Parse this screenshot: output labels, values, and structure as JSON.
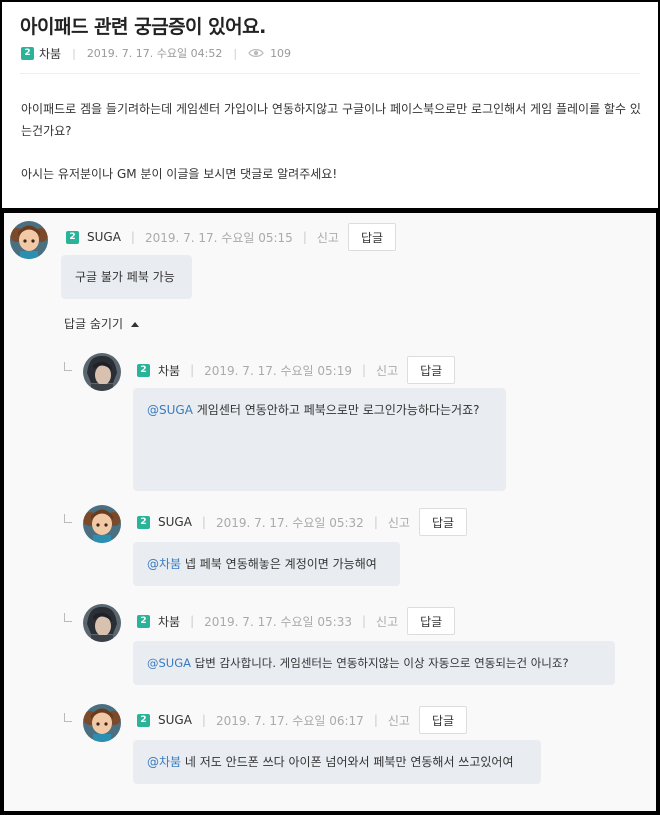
{
  "post": {
    "title": "아이패드 관련 궁금증이 있어요.",
    "level": "2",
    "author": "차붐",
    "date": "2019. 7. 17. 수요일 04:52",
    "views": "109",
    "body_line1": "아이패드로 겜을 들기려하는데 게임센터 가입이나 연동하지않고 구글이나 페이스북으로만 로그인해서 게임 플레이를 할수 있는건가요?",
    "body_line2": "아시는 유저분이나 GM 분이 이글을 보시면 댓글로 알려주세요!"
  },
  "labels": {
    "report": "신고",
    "reply": "답글",
    "hide_replies": "답글 숨기기"
  },
  "comments": [
    {
      "level": "2",
      "author": "SUGA",
      "date": "2019. 7. 17. 수요일 05:15",
      "mention": "",
      "text": "구글 불가 페북 가능"
    },
    {
      "level": "2",
      "author": "차붐",
      "date": "2019. 7. 17. 수요일 05:19",
      "mention": "@SUGA",
      "text": " 게임센터 연동안하고 페북으로만 로그인가능하다는거죠?"
    },
    {
      "level": "2",
      "author": "SUGA",
      "date": "2019. 7. 17. 수요일 05:32",
      "mention": "@차붐",
      "text": " 넵 페북 연동해놓은 계정이면 가능해여"
    },
    {
      "level": "2",
      "author": "차붐",
      "date": "2019. 7. 17. 수요일 05:33",
      "mention": "@SUGA",
      "text": " 답변 감사합니다. 게임센터는 연동하지않는 이상 자동으로 연동되는건 아니죠?"
    },
    {
      "level": "2",
      "author": "SUGA",
      "date": "2019. 7. 17. 수요일 06:17",
      "mention": "@차붐",
      "text": " 네 저도 안드폰 쓰다 아이폰 넘어와서 페북만 연동해서 쓰고있어여"
    }
  ],
  "icons": {
    "views": "eye-icon",
    "avatar_suga": "girl-character-avatar",
    "avatar_chaboom": "dark-hair-character-avatar",
    "toggle": "caret-up-icon",
    "indent": "reply-indent-icon"
  },
  "colors": {
    "level_badge": "#2bb39a",
    "mention": "#3a7bbf",
    "bubble": "#e9edf1"
  }
}
